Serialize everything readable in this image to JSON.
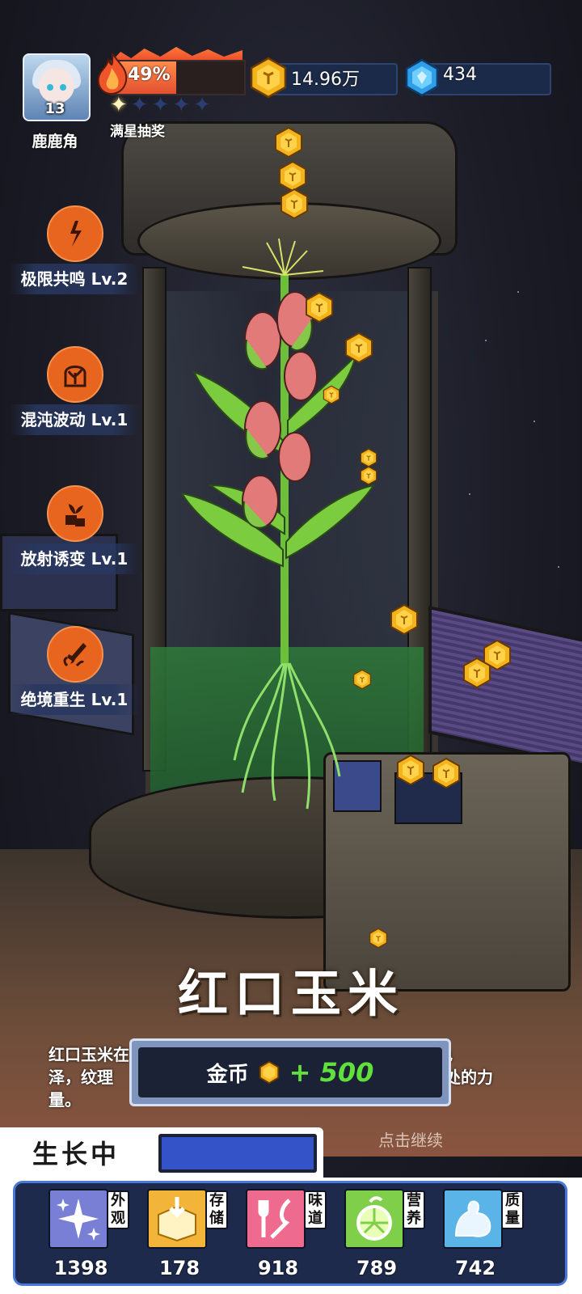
{
  "player": {
    "name": "鹿鹿角",
    "level": "13",
    "energy_percent": "49%",
    "energy_value": 0.49,
    "star_lottery_label": "满星抽奖",
    "stars_filled": 1,
    "stars_total": 5
  },
  "resources": {
    "coins": "14.96万",
    "gems": "434"
  },
  "skills": [
    {
      "label": "极限共鸣 Lv.2",
      "icon": "lightning-plant-icon"
    },
    {
      "label": "混沌波动 Lv.1",
      "icon": "bell-jar-plant-icon"
    },
    {
      "label": "放射诱变 Lv.1",
      "icon": "sprout-box-icon"
    },
    {
      "label": "绝境重生 Lv.1",
      "icon": "sword-plant-icon"
    }
  ],
  "result": {
    "title": "红口玉米",
    "description_line1": "红口玉米在极限共鸣的刺激下完成进化，籽粒转为深红色",
    "description_line2": "泽，纹理",
    "description_line2_end": "处的力",
    "description_line3": "量。",
    "reward_label": "金币",
    "reward_value": "+ 500",
    "continue_label": "点击继续"
  },
  "growth": {
    "status_label": "生长中",
    "progress": 1.0
  },
  "stats": [
    {
      "tag": "外观",
      "value": "1398",
      "icon": "sparkle-icon",
      "color": "#7a7fd6"
    },
    {
      "tag": "存储",
      "value": "178",
      "icon": "storage-box-icon",
      "color": "#f3b43a"
    },
    {
      "tag": "味道",
      "value": "918",
      "icon": "fork-knife-icon",
      "color": "#ef6a8f"
    },
    {
      "tag": "营养",
      "value": "789",
      "icon": "lemon-icon",
      "color": "#7fcf4a"
    },
    {
      "tag": "质量",
      "value": "742",
      "icon": "muscle-arm-icon",
      "color": "#5ab4e8"
    }
  ],
  "colors": {
    "accent_orange": "#e8651f",
    "reward_green": "#5fe03a",
    "panel_blue": "#1d2a4c",
    "progress_blue": "#3553c9"
  }
}
